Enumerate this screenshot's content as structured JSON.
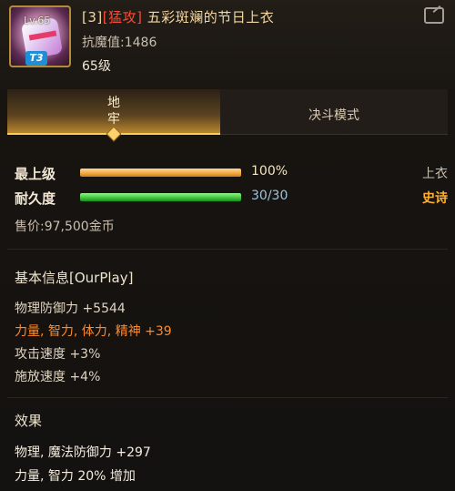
{
  "header": {
    "level_badge": "Lv.65",
    "tier_badge": "T3",
    "title_prefix": "[3]",
    "title_tag": "[猛攻]",
    "title_name": " 五彩斑斓的节日上衣",
    "resist": "抗魔值:1486",
    "level": "65级"
  },
  "tabs": [
    {
      "label": "地\n牢",
      "active": true
    },
    {
      "label": "决斗模式",
      "active": false
    }
  ],
  "stats": {
    "max_level": {
      "label": "最上级",
      "value_text": "100%",
      "fill": 1.0,
      "right": "上衣"
    },
    "durability": {
      "label": "耐久度",
      "value_text": "30/30",
      "fill": 1.0,
      "right": "史诗"
    }
  },
  "price": "售价:97,500金币",
  "basic_info": {
    "title": "基本信息[OurPlay]",
    "lines": [
      {
        "text": "物理防御力 +5544",
        "style": "plain"
      },
      {
        "text": "力量, 智力, 体力, 精神 +39",
        "style": "orange"
      },
      {
        "text": "攻击速度 +3%",
        "style": "plain"
      },
      {
        "text": "施放速度 +4%",
        "style": "plain"
      }
    ]
  },
  "effect": {
    "title": "效果",
    "lines": [
      {
        "text": "物理, 魔法防御力 +297",
        "style": "bright"
      },
      {
        "text": "力量, 智力 20% 增加",
        "style": "bright"
      }
    ]
  },
  "colors": {
    "accent_gold": "#ffcc55",
    "tag_red": "#ff4a36",
    "epic_orange": "#ffb02e",
    "stat_orange": "#ff8a2a"
  }
}
